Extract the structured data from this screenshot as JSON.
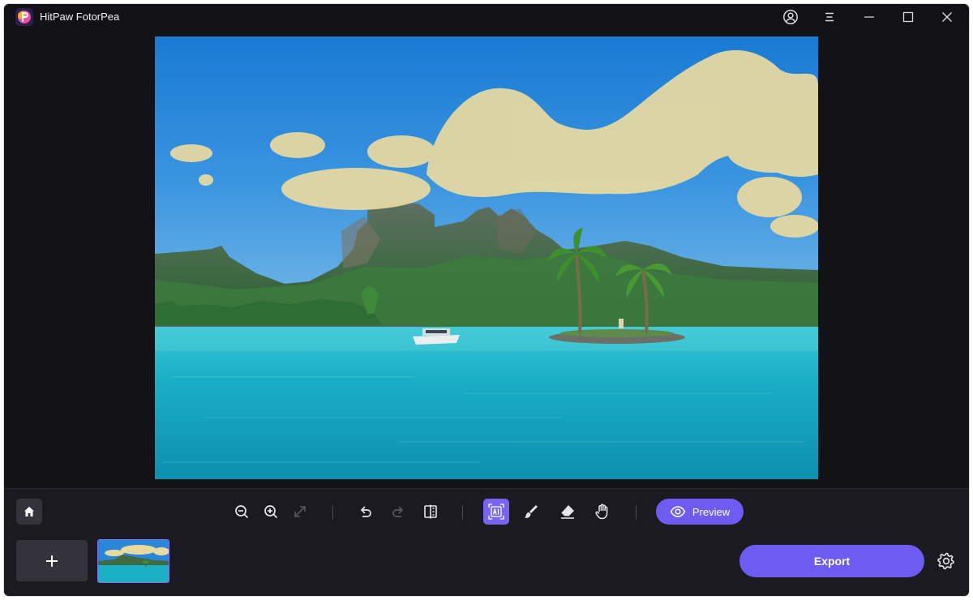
{
  "window": {
    "title": "HitPaw FotorPea",
    "controls": [
      "account-icon",
      "menu-icon",
      "minimize-icon",
      "maximize-icon",
      "close-icon"
    ]
  },
  "canvas": {
    "content": "tropical-lagoon-photo",
    "mask_color": "#e8d9a0"
  },
  "toolbar": {
    "tools": [
      "zoom-out-icon",
      "zoom-in-icon",
      "fit-screen-icon",
      "undo-icon",
      "redo-icon",
      "compare-icon",
      "ai-select-icon",
      "brush-icon",
      "eraser-icon",
      "hand-icon"
    ],
    "active_tool": "ai-select-icon",
    "preview_label": "Preview"
  },
  "footer": {
    "export_label": "Export"
  },
  "colors": {
    "accent": "#6e5cf2",
    "background": "#121116",
    "panel": "#1b1a20"
  }
}
